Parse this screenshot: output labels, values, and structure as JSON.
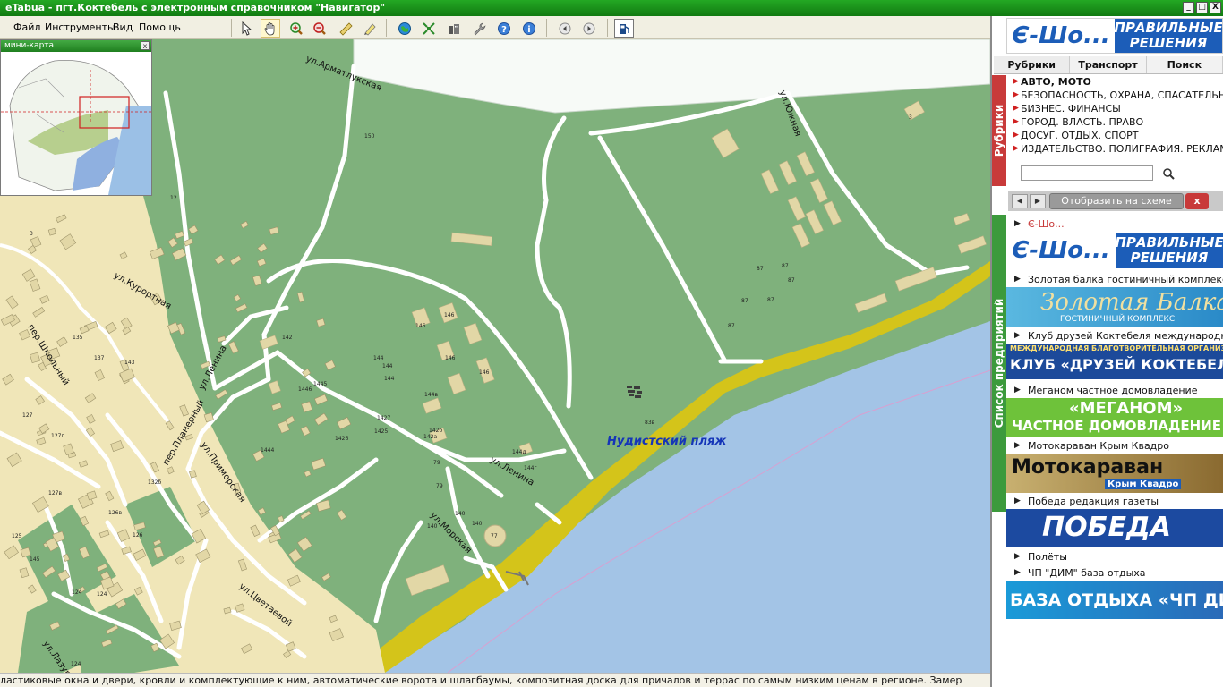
{
  "window": {
    "title": "eTabua - пгт.Коктебель с электронным справочником \"Навигатор\"",
    "min": "_",
    "max": "□",
    "close": "X"
  },
  "menu": {
    "file": "Файл",
    "tools": "Инструменты",
    "view": "Вид",
    "help": "Помощь"
  },
  "minimap": {
    "title": "мини-карта",
    "close": "x"
  },
  "map": {
    "streets": {
      "armatlukskaya": "ул.Арматлукская",
      "yuzhnaya": "ул.Южная",
      "kurortnaya": "ул.Курортная",
      "shkolny": "пер.Школьный",
      "lenina1": "ул.Ленина",
      "lenina2": "ул.Ленина",
      "planerny": "пер.Планерный",
      "primorskaya": "ул.Приморская",
      "morskaya": "ул.Морская",
      "tsvetaevoy": "ул.Цветаевой",
      "lazurnaya": "ул.Лазурная"
    },
    "beach_label": "Нудистский пляж",
    "numbers": [
      "150",
      "12",
      "3",
      "87",
      "87",
      "87",
      "87",
      "87",
      "87",
      "3",
      "142",
      "146",
      "146",
      "146",
      "146",
      "144",
      "144",
      "144",
      "144в",
      "142б",
      "142а",
      "79",
      "79",
      "144д",
      "144г",
      "140",
      "140",
      "140",
      "77",
      "1445",
      "1446",
      "1444",
      "1425",
      "1426",
      "1427",
      "135",
      "137",
      "143",
      "127",
      "127г",
      "127в",
      "125",
      "124",
      "124",
      "124",
      "132б",
      "126в",
      "126",
      "83в",
      "145"
    ]
  },
  "ticker": {
    "text": "ластиковые окна и двери, кровли и комплектующие к ним, автоматические ворота и шлагбаумы, композитная доска для причалов и террас по самым низким ценам в регионе. Замер"
  },
  "right_panel": {
    "logo": {
      "e": "Є-Шо...",
      "slogan_line1": "ПРАВИЛЬНЫЕ",
      "slogan_line2": "РЕШЕНИЯ"
    },
    "tabs": [
      "Рубрики",
      "Транспорт",
      "Поиск"
    ],
    "rubriki_tab": "Рубрики",
    "categories": [
      "АВТО, МОТО",
      "БЕЗОПАСНОСТЬ, ОХРАНА, СПАСАТЕЛЬНЫЕ",
      "БИЗНЕС. ФИНАНСЫ",
      "ГОРОД. ВЛАСТЬ. ПРАВО",
      "ДОСУГ. ОТДЫХ. СПОРТ",
      "ИЗДАТЕЛЬСТВО. ПОЛИГРАФИЯ. РЕКЛАМА"
    ],
    "show_on_map": "Отобразить на схеме",
    "close_x": "x",
    "list_tab": "Список предприятий",
    "companies": {
      "c0": "Є-Шо...",
      "c1": "Золотая балка гостиничный комплекс",
      "c2": "Клуб друзей Коктебеля международная",
      "c3": "Меганом частное домовладение",
      "c4": "Мотокараван Крым Квадро",
      "c5": "Победа редакция газеты",
      "c6": "Полёты",
      "c7": "ЧП \"ДИМ\" база отдыха"
    },
    "banners": {
      "zb_title": "Золотая Балка",
      "zb_sub": "ГОСТИНИЧНЫЙ КОМПЛЕКС",
      "klub_top": "МЕЖДУНАРОДНАЯ БЛАГОТВОРИТЕЛЬНАЯ ОРГАНИЗАЦИЯ",
      "klub_main": "КЛУБ «ДРУЗЕЙ КОКТЕБЕЛЯ»",
      "meg_1": "«МЕГАНОМ»",
      "meg_2": "ЧАСТНОЕ ДОМОВЛАДЕНИЕ",
      "moto_1": "Мотокараван",
      "moto_2": "Крым Квадро",
      "pobeda": "ПОБЕДА",
      "dim": "БАЗА ОТДЫХА «ЧП ДИМ»"
    },
    "colors": {
      "green": "#3c9a3c",
      "red": "#c83a3a",
      "blue": "#1c5db8"
    }
  }
}
